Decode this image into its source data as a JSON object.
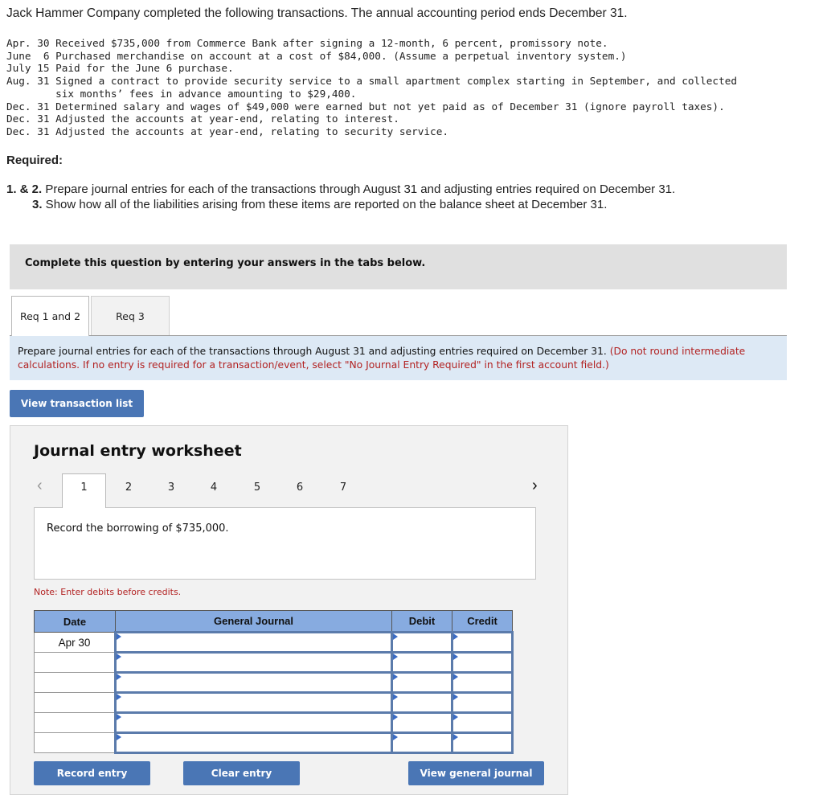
{
  "intro": "Jack Hammer Company completed the following transactions. The annual accounting period ends December 31.",
  "transactions": [
    "Apr. 30 Received $735,000 from Commerce Bank after signing a 12-month, 6 percent, promissory note.",
    "June  6 Purchased merchandise on account at a cost of $84,000. (Assume a perpetual inventory system.)",
    "July 15 Paid for the June 6 purchase.",
    "Aug. 31 Signed a contract to provide security service to a small apartment complex starting in September, and collected",
    "        six months’ fees in advance amounting to $29,400.",
    "Dec. 31 Determined salary and wages of $49,000 were earned but not yet paid as of December 31 (ignore payroll taxes).",
    "Dec. 31 Adjusted the accounts at year-end, relating to interest.",
    "Dec. 31 Adjusted the accounts at year-end, relating to security service."
  ],
  "required": {
    "heading": "Required:",
    "item1_num": "1. & 2.",
    "item1_text": " Prepare journal entries for each of the transactions through August 31 and adjusting entries required on December 31.",
    "item2_num": "3.",
    "item2_text": " Show how all of the liabilities arising from these items are reported on the balance sheet at December 31."
  },
  "banner": "Complete this question by entering your answers in the tabs below.",
  "tabs": [
    {
      "label": "Req 1 and 2",
      "active": true
    },
    {
      "label": "Req 3",
      "active": false
    }
  ],
  "instructions": {
    "main": "Prepare journal entries for each of the transactions through August 31 and adjusting entries required on December 31. ",
    "note": "(Do not round intermediate calculations. If no entry is required for a transaction/event, select \"No Journal Entry Required\" in the first account field.)"
  },
  "view_transaction_list_label": "View transaction list",
  "worksheet": {
    "title": "Journal entry worksheet",
    "pages": [
      "1",
      "2",
      "3",
      "4",
      "5",
      "6",
      "7"
    ],
    "active_page": "1",
    "prev_icon": "‹",
    "next_icon": "›",
    "description": "Record the borrowing of $735,000.",
    "note": "Note: Enter debits before credits.",
    "table": {
      "headers": [
        "Date",
        "General Journal",
        "Debit",
        "Credit"
      ],
      "rows": [
        {
          "date": "Apr 30",
          "account": "",
          "debit": "",
          "credit": ""
        },
        {
          "date": "",
          "account": "",
          "debit": "",
          "credit": ""
        },
        {
          "date": "",
          "account": "",
          "debit": "",
          "credit": ""
        },
        {
          "date": "",
          "account": "",
          "debit": "",
          "credit": ""
        },
        {
          "date": "",
          "account": "",
          "debit": "",
          "credit": ""
        },
        {
          "date": "",
          "account": "",
          "debit": "",
          "credit": ""
        }
      ]
    },
    "buttons": {
      "record": "Record entry",
      "clear": "Clear entry",
      "view_journal": "View general journal"
    }
  }
}
